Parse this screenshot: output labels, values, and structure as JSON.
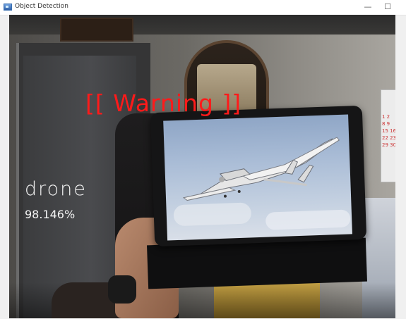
{
  "window": {
    "title": "Object Detection",
    "minimize_glyph": "—",
    "maximize_glyph": "☐"
  },
  "detection": {
    "warning": "[[ Warning ]]",
    "label": "drone",
    "confidence": "98.146%"
  },
  "calendar": {
    "numbers": "1 2\n8 9\n15 16\n22 23\n29 30"
  },
  "colors": {
    "warning": "#ff1a1a",
    "label": "#f4f4f4"
  }
}
